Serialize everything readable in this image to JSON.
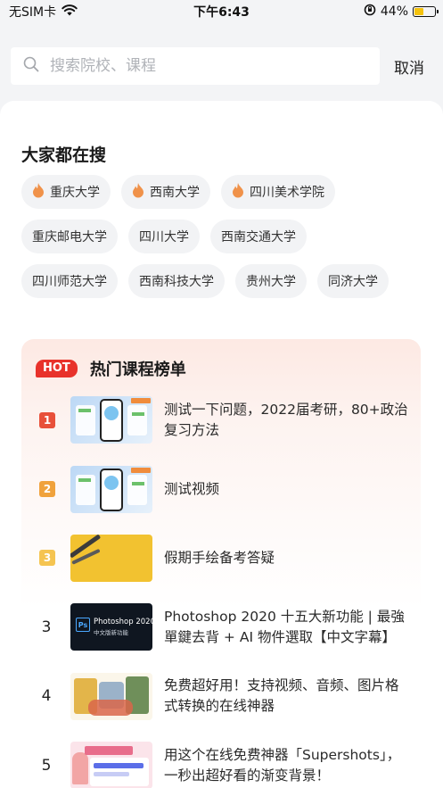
{
  "status_bar": {
    "carrier": "无SIM卡",
    "time": "下午6:43",
    "battery_text": "44%",
    "battery_level": 0.44
  },
  "search": {
    "placeholder": "搜索院校、课程",
    "value": "",
    "cancel_label": "取消"
  },
  "hot_search": {
    "title": "大家都在搜",
    "rows": [
      [
        {
          "label": "重庆大学",
          "hot": true
        },
        {
          "label": "西南大学",
          "hot": true
        },
        {
          "label": "四川美术学院",
          "hot": true
        }
      ],
      [
        {
          "label": "重庆邮电大学",
          "hot": false
        },
        {
          "label": "四川大学",
          "hot": false
        },
        {
          "label": "西南交通大学",
          "hot": false
        }
      ],
      [
        {
          "label": "四川师范大学",
          "hot": false
        },
        {
          "label": "西南科技大学",
          "hot": false
        },
        {
          "label": "贵州大学",
          "hot": false
        },
        {
          "label": "同济大学",
          "hot": false
        }
      ]
    ]
  },
  "hot_courses": {
    "badge": "HOT",
    "title": "热门课程榜单",
    "items": [
      {
        "rank": "1",
        "title": "测试一下问题，2022届考研，80+政治复习方法",
        "thumb": "app"
      },
      {
        "rank": "2",
        "title": "测试视频",
        "thumb": "app"
      },
      {
        "rank": "3",
        "title": "假期手绘备考答疑",
        "thumb": "yellow"
      },
      {
        "rank": "3",
        "title": "Photoshop 2020 十五大新功能 | 最強單鍵去背 + AI 物件選取【中文字幕】",
        "thumb": "ps",
        "thumb_text_1": "Photoshop 2020",
        "thumb_text_2": "中文版新功能"
      },
      {
        "rank": "4",
        "title": "免费超好用！支持视频、音频、图片格式转换的在线神器",
        "thumb": "cartoon"
      },
      {
        "rank": "5",
        "title": "用这个在线免费神器「Supershots」，一秒出超好看的渐变背景！",
        "thumb": "design"
      }
    ]
  },
  "colors": {
    "hot_badge": "#e8322b",
    "rank1": "#e8503a",
    "rank2": "#f0a23c",
    "rank3": "#f5c451",
    "flame": "#f0924a"
  }
}
